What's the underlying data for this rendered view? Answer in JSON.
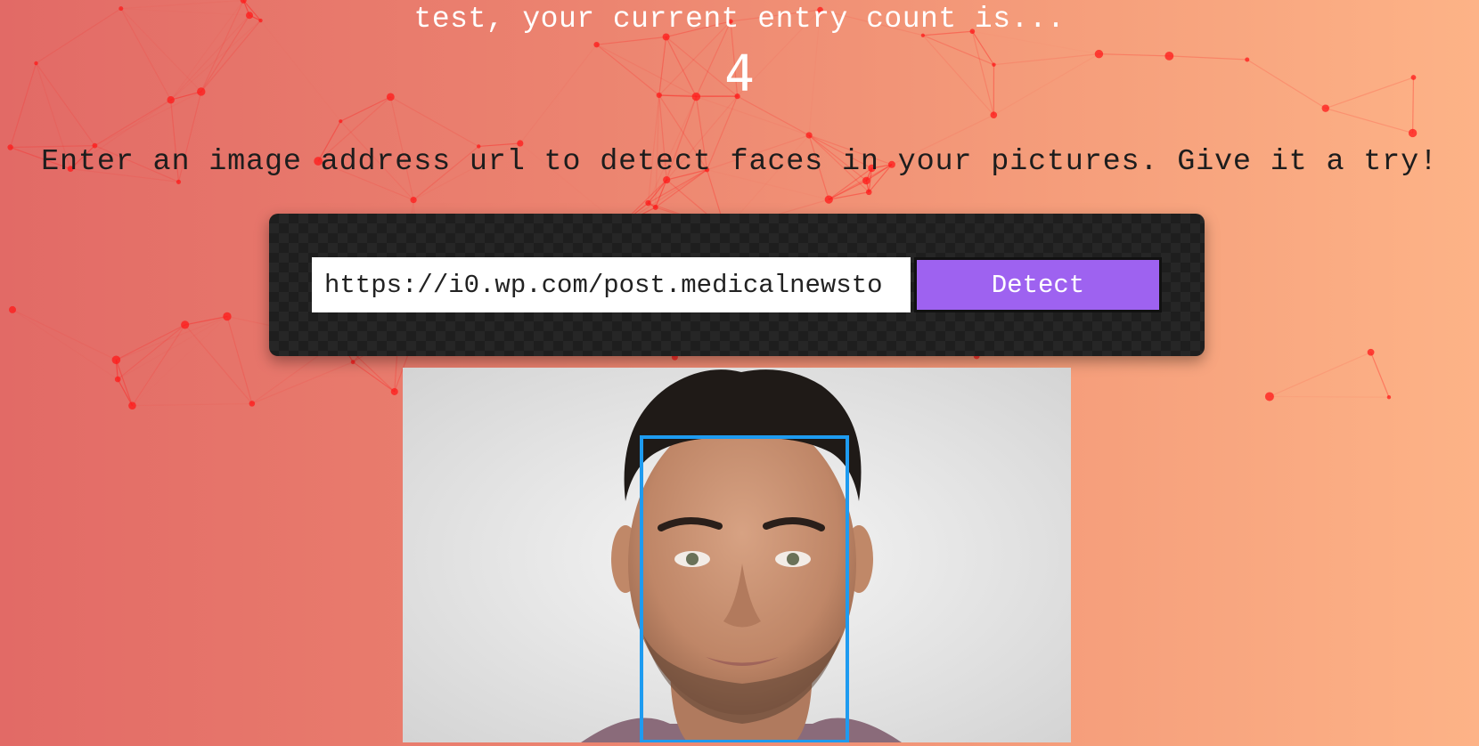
{
  "greeting": {
    "text": "test, your current entry count is...",
    "count": "4"
  },
  "instructions": "Enter an image address url to detect faces in your pictures. Give it a try!",
  "form": {
    "url_value": "https://i0.wp.com/post.medicalnewsto",
    "detect_label": "Detect"
  },
  "result": {
    "face_count_boxes": 1,
    "box_color": "#1e9bf0"
  },
  "colors": {
    "gradient_start": "#e26a66",
    "gradient_end": "#fdb387",
    "button": "#9e62f0",
    "particles": "#ff1a1a"
  }
}
